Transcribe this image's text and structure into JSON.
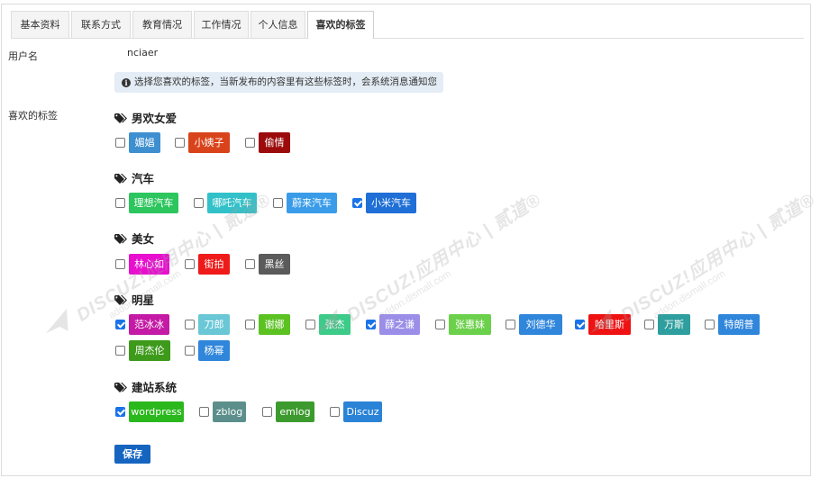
{
  "tabs": [
    {
      "label": "基本资料",
      "active": false
    },
    {
      "label": "联系方式",
      "active": false
    },
    {
      "label": "教育情况",
      "active": false
    },
    {
      "label": "工作情况",
      "active": false
    },
    {
      "label": "个人信息",
      "active": false
    },
    {
      "label": "喜欢的标签",
      "active": true
    }
  ],
  "username_label": "用户名",
  "username_value": "nciaer",
  "notice_text": "选择您喜欢的标签，当新发布的内容里有这些标签时，会系统消息通知您",
  "tags_label": "喜欢的标签",
  "groups": [
    {
      "title": "男欢女爱",
      "tags": [
        {
          "name": "媚娼",
          "checked": false,
          "color": "#3d8fd0"
        },
        {
          "name": "小姨子",
          "checked": false,
          "color": "#d9431b"
        },
        {
          "name": "偷情",
          "checked": false,
          "color": "#9b0b0b"
        }
      ]
    },
    {
      "title": "汽车",
      "tags": [
        {
          "name": "理想汽车",
          "checked": false,
          "color": "#2dc55e"
        },
        {
          "name": "哪吒汽车",
          "checked": false,
          "color": "#33c1c9"
        },
        {
          "name": "蔚来汽车",
          "checked": false,
          "color": "#3a9ce8"
        },
        {
          "name": "小米汽车",
          "checked": true,
          "color": "#1f6fd6"
        }
      ]
    },
    {
      "title": "美女",
      "tags": [
        {
          "name": "林心如",
          "checked": false,
          "color": "#e80fcf"
        },
        {
          "name": "街拍",
          "checked": false,
          "color": "#ef1a1a"
        },
        {
          "name": "黑丝",
          "checked": false,
          "color": "#5b5b5b"
        }
      ]
    },
    {
      "title": "明星",
      "tags": [
        {
          "name": "范冰冰",
          "checked": true,
          "color": "#c41aa5"
        },
        {
          "name": "刀郎",
          "checked": false,
          "color": "#6ac7d6"
        },
        {
          "name": "谢娜",
          "checked": false,
          "color": "#5cc222"
        },
        {
          "name": "张杰",
          "checked": false,
          "color": "#3ccb88"
        },
        {
          "name": "薛之谦",
          "checked": true,
          "color": "#9b8ee8"
        },
        {
          "name": "张惠妹",
          "checked": false,
          "color": "#6bd04a"
        },
        {
          "name": "刘德华",
          "checked": false,
          "color": "#2f86db"
        },
        {
          "name": "哈里斯",
          "checked": true,
          "color": "#ef1212"
        },
        {
          "name": "万斯",
          "checked": false,
          "color": "#2e9e9e"
        },
        {
          "name": "特朗普",
          "checked": false,
          "color": "#2f86db"
        },
        {
          "name": "周杰伦",
          "checked": false,
          "color": "#3d9a1a"
        },
        {
          "name": "杨幂",
          "checked": false,
          "color": "#2f86db"
        }
      ]
    },
    {
      "title": "建站系统",
      "tags": [
        {
          "name": "wordpress",
          "checked": true,
          "color": "#2ab81d"
        },
        {
          "name": "zblog",
          "checked": false,
          "color": "#5c8f8c"
        },
        {
          "name": "emlog",
          "checked": false,
          "color": "#3d9a2e"
        },
        {
          "name": "Discuz",
          "checked": false,
          "color": "#2a83d6"
        }
      ]
    }
  ],
  "save_label": "保存",
  "watermark": {
    "main": "DISCUZ!应用中心 | 贰道®",
    "sub": "addon.dismall.com"
  },
  "icons": {
    "info": "info-circle-icon",
    "tag": "tags-icon",
    "check": "checkmark-icon"
  }
}
